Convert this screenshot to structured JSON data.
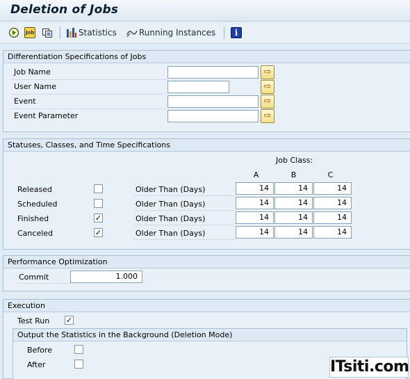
{
  "window": {
    "title": "Deletion of Jobs"
  },
  "toolbar": {
    "icons": [
      "execute-clock-icon",
      "job-icon",
      "job-variant-icon"
    ],
    "statistics_label": "Statistics",
    "running_instances_label": "Running Instances",
    "info_icon": "info-icon"
  },
  "differentiation": {
    "header": "Differentiation Specifications of Jobs",
    "fields": [
      {
        "label": "Job Name",
        "value": ""
      },
      {
        "label": "User Name",
        "value": ""
      },
      {
        "label": "Event",
        "value": ""
      },
      {
        "label": "Event Parameter",
        "value": ""
      }
    ]
  },
  "statuses": {
    "header": "Statuses, Classes, and Time Specifications",
    "job_class_label": "Job Class:",
    "class_headers": [
      "A",
      "B",
      "C"
    ],
    "older_than_label": "Older Than (Days)",
    "rows": [
      {
        "label": "Released",
        "checked": false,
        "values": [
          "14",
          "14",
          "14"
        ]
      },
      {
        "label": "Scheduled",
        "checked": false,
        "values": [
          "14",
          "14",
          "14"
        ]
      },
      {
        "label": "Finished",
        "checked": true,
        "values": [
          "14",
          "14",
          "14"
        ]
      },
      {
        "label": "Canceled",
        "checked": true,
        "values": [
          "14",
          "14",
          "14"
        ]
      }
    ]
  },
  "performance": {
    "header": "Performance Optimization",
    "commit_label": "Commit",
    "commit_value": "1.000"
  },
  "execution": {
    "header": "Execution",
    "test_run_label": "Test Run",
    "test_run_checked": true,
    "output_header": "Output the Statistics in the Background (Deletion Mode)",
    "before_label": "Before",
    "before_checked": false,
    "after_label": "After",
    "after_checked": false
  },
  "watermark": "ITsiti.com",
  "check_glyph": "✓"
}
